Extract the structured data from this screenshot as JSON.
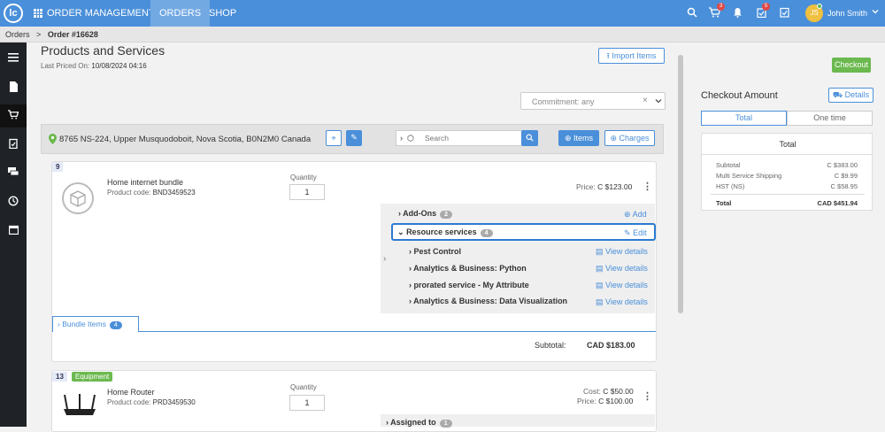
{
  "topbar": {
    "logo": "lc",
    "app_title": "ORDER MANAGEMENT",
    "nav_orders": "ORDERS",
    "nav_shop": "SHOP",
    "cart_count": "3",
    "tasks_count": "5",
    "user_initials": "JS",
    "user_name": "John Smith"
  },
  "breadcrumb": {
    "root": "Orders",
    "sep": ">",
    "current": "Order #16628"
  },
  "section": {
    "title": "Products and Services",
    "last_priced_label": "Last Priced On:",
    "last_priced_value": "10/08/2024 04:16",
    "import_items": "Import Items",
    "commitment": "Commitment: any"
  },
  "address_bar": {
    "address": "8765 NS-224, Upper Musquodoboit, Nova Scotia, B0N2M0 Canada",
    "search_placeholder": "Search",
    "items_btn": "Items",
    "charges_btn": "Charges"
  },
  "item1": {
    "number": "9",
    "name": "Home internet bundle",
    "code_label": "Product code:",
    "code": "BND3459523",
    "qty_label": "Quantity",
    "qty": "1",
    "price_label": "Price:",
    "price": "C $123.00",
    "addons_label": "Add-Ons",
    "addons_count": "2",
    "add_link": "Add",
    "resources_label": "Resource services",
    "resources_count": "4",
    "edit_link": "Edit",
    "services": [
      {
        "name": "Pest Control",
        "link": "View details"
      },
      {
        "name": "Analytics & Business: Python",
        "link": "View details"
      },
      {
        "name": "prorated service - My Attribute",
        "link": "View details"
      },
      {
        "name": "Analytics & Business: Data Visualization",
        "link": "View details"
      }
    ],
    "bundle_label": "Bundle Items",
    "bundle_count": "4",
    "subtotal_label": "Subtotal:",
    "subtotal": "CAD $183.00"
  },
  "item2": {
    "number": "13",
    "tag": "Equipment",
    "name": "Home Router",
    "code_label": "Product code:",
    "code": "PRD3459530",
    "qty_label": "Quantity",
    "qty": "1",
    "cost_label": "Cost:",
    "cost": "C $50.00",
    "price_label": "Price:",
    "price": "C $100.00",
    "assigned_label": "Assigned to",
    "assigned_count": "1"
  },
  "checkout": {
    "button": "Checkout",
    "title": "Checkout Amount",
    "details_btn": "Details",
    "tab_total": "Total",
    "tab_onetime": "One time",
    "table_title": "Total",
    "rows": [
      {
        "label": "Subtotal",
        "value": "C $383.00"
      },
      {
        "label": "Multi Service Shipping",
        "value": "C $9.99"
      },
      {
        "label": "HST (NS)",
        "value": "C $58.95"
      }
    ],
    "total_label": "Total",
    "total_value": "CAD $451.94"
  },
  "colors": {
    "accent": "#4a8fd9",
    "sidebar": "#1f2328",
    "success": "#6cb94f",
    "danger": "#e04848"
  }
}
